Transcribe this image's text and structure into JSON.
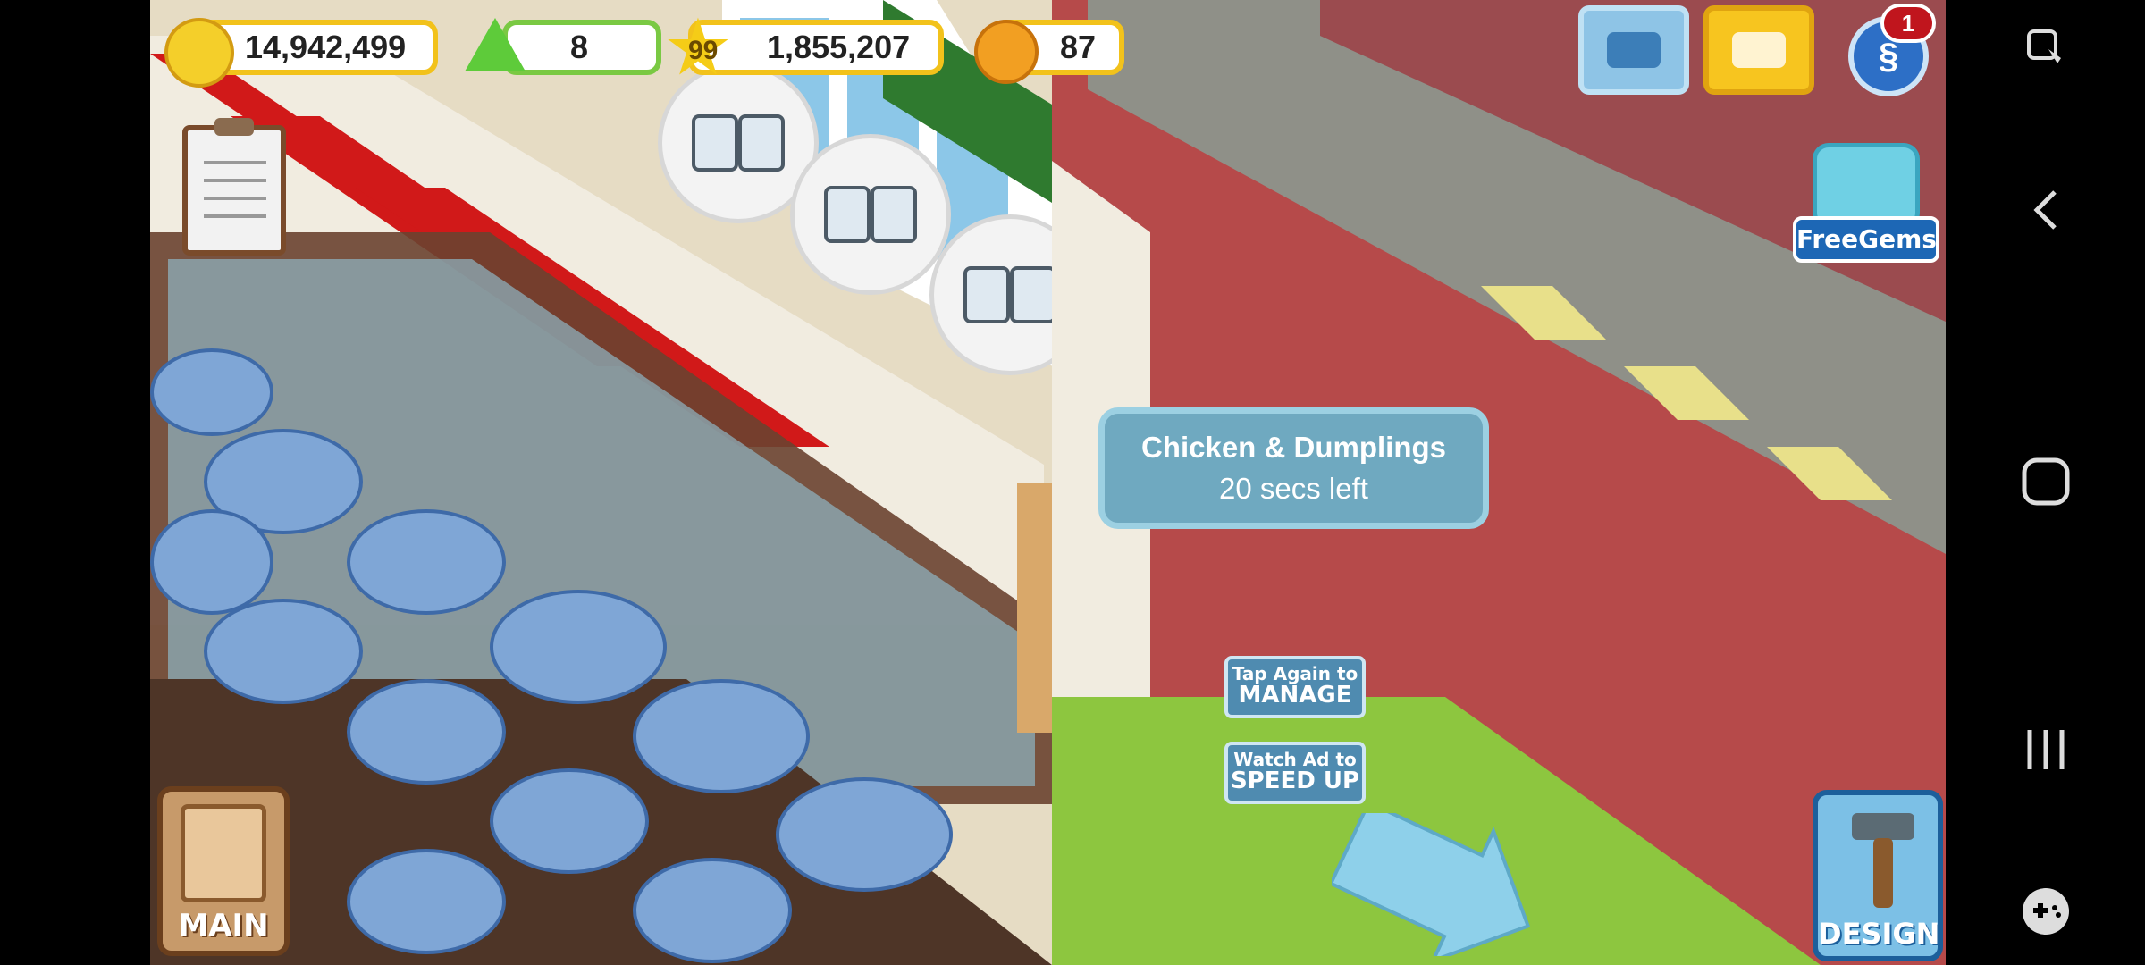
{
  "hud": {
    "coins": "14,942,499",
    "gems": "8",
    "level": "99",
    "xp": "1,855,207",
    "happiness": "87",
    "notification_count": "1"
  },
  "side": {
    "free_gems_label": "FreeGems"
  },
  "tooltip": {
    "title": "Chicken & Dumplings",
    "timer": "20 secs left"
  },
  "buttons": {
    "manage_line1": "Tap Again to",
    "manage_line2": "MANAGE",
    "speed_line1": "Watch Ad to",
    "speed_line2": "SPEED UP",
    "main_label": "MAIN",
    "design_label": "DESIGN"
  },
  "colors": {
    "hud_border": "#f2c21b",
    "gem_border": "#7ac943",
    "tooltip_bg": "#6fa9c0",
    "floor_green": "#8dc63f",
    "road": "#8f9088"
  },
  "icons": [
    "coin-icon",
    "gem-icon",
    "star-icon",
    "smiley-icon",
    "camera-icon",
    "phone-icon",
    "social-icon",
    "clipboard-icon",
    "hammer-icon",
    "arrow-icon"
  ]
}
